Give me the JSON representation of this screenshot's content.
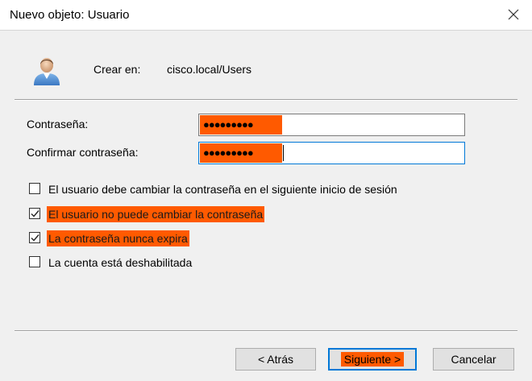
{
  "window": {
    "title": "Nuevo objeto: Usuario"
  },
  "header": {
    "crear_label": "Crear en:",
    "crear_value": "cisco.local/Users"
  },
  "fields": {
    "password_label": "Contraseña:",
    "password_value": "●●●●●●●●●",
    "confirm_label": "Confirmar contraseña:",
    "confirm_value": "●●●●●●●●●"
  },
  "options": [
    {
      "label": "El usuario debe cambiar la contraseña en el siguiente inicio de sesión",
      "checked": false
    },
    {
      "label": "El usuario no puede cambiar la contraseña",
      "checked": true
    },
    {
      "label": "La contraseña nunca expira",
      "checked": true
    },
    {
      "label": "La cuenta está deshabilitada",
      "checked": false
    }
  ],
  "buttons": {
    "back": "< Atrás",
    "next": "Siguiente >",
    "cancel": "Cancelar"
  },
  "colors": {
    "highlight": "#ff5a00",
    "focus": "#0078d7"
  }
}
